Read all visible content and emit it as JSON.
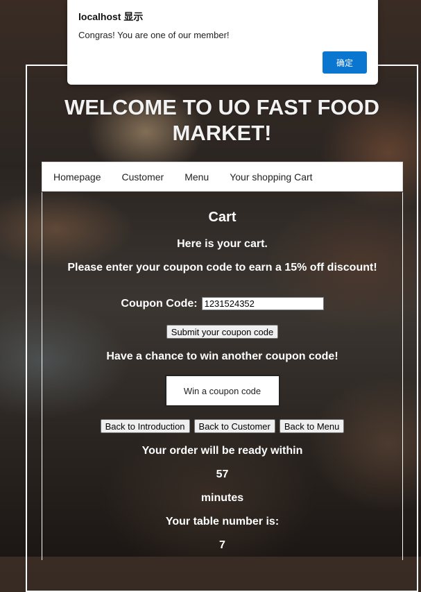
{
  "title": "WELCOME TO UO FAST FOOD MARKET!",
  "nav": {
    "items": [
      "Homepage",
      "Customer",
      "Menu",
      "Your shopping Cart"
    ]
  },
  "cart": {
    "heading": "Cart",
    "intro": "Here is your cart.",
    "coupon_prompt": "Please enter your coupon code to earn a 15% off discount!",
    "coupon_label": "Coupon Code:",
    "coupon_value": "1231524352",
    "submit_label": "Submit your coupon code",
    "chance_text": "Have a chance to win another coupon code!",
    "win_label": "Win a coupon code",
    "back_buttons": [
      "Back to Introduction",
      "Back to Customer",
      "Back to Menu"
    ],
    "order_ready_text": "Your order will be ready within",
    "minutes_value": "57",
    "minutes_label": "minutes",
    "table_text": "Your table number is:",
    "table_value": "7"
  },
  "dialog": {
    "title": "localhost 显示",
    "message": "Congras! You are one of our member!",
    "ok_label": "确定"
  },
  "colors": {
    "dialog_button": "#0b76d0",
    "text": "#ffffff"
  }
}
